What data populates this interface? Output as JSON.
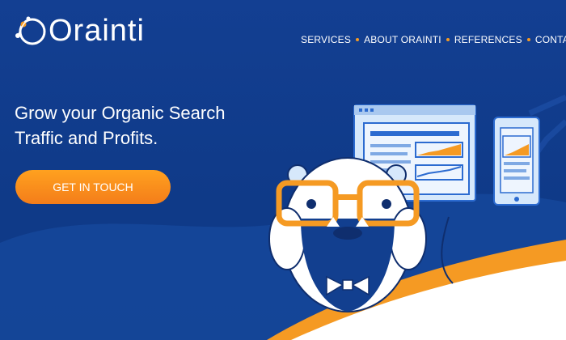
{
  "brand": {
    "name": "Orainti",
    "icon": "orbit-logo-icon"
  },
  "nav": {
    "items": [
      {
        "label": "SERVICES"
      },
      {
        "label": "ABOUT ORAINTI"
      },
      {
        "label": "REFERENCES"
      },
      {
        "label": "CONTACT"
      }
    ],
    "separator_icon": "orange-dot-icon"
  },
  "hero": {
    "headline_line1": "Grow your Organic Search",
    "headline_line2": "Traffic and Profits.",
    "cta_label": "GET IN TOUCH"
  },
  "colors": {
    "background": "#123f8f",
    "accent": "#f59a23",
    "text": "#ffffff",
    "illustration_light": "#d6e8fb"
  },
  "illustration": {
    "icons": [
      "browser-window-icon",
      "mobile-phone-icon",
      "growth-arrow-icon",
      "mascot-with-glasses-icon",
      "bowtie-icon"
    ]
  }
}
